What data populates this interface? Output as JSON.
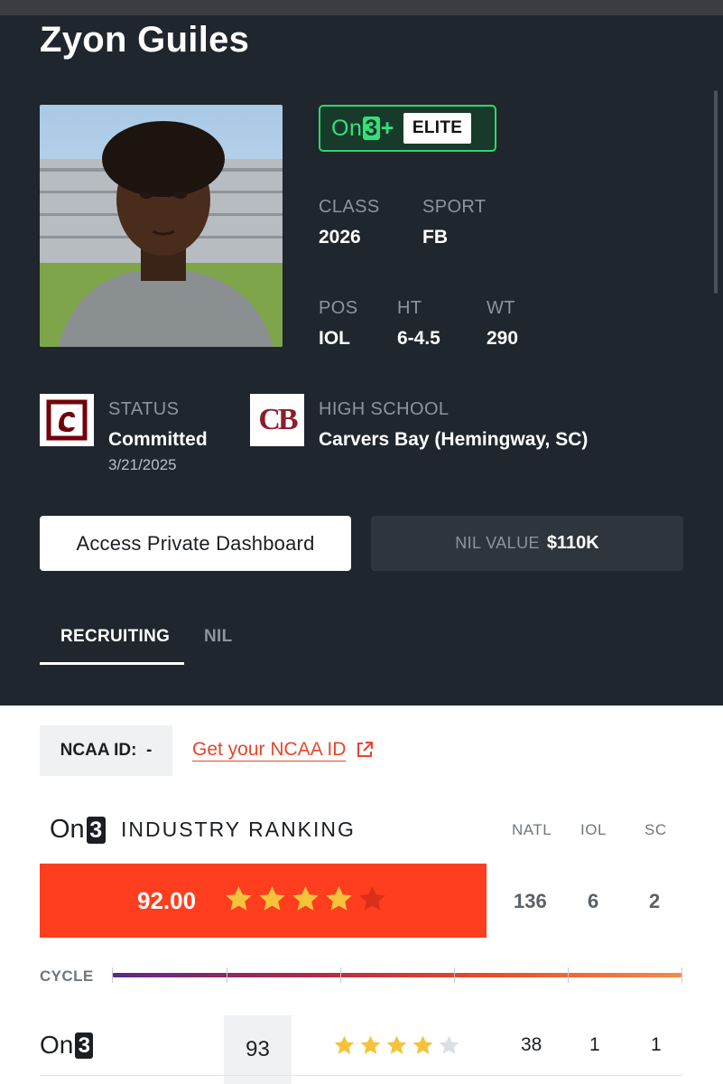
{
  "player": {
    "name": "Zyon Guiles",
    "badge": {
      "brand": "On3+",
      "tier": "ELITE"
    },
    "class_label": "CLASS",
    "class_value": "2026",
    "sport_label": "SPORT",
    "sport_value": "FB",
    "pos_label": "POS",
    "pos_value": "IOL",
    "ht_label": "HT",
    "ht_value": "6-4.5",
    "wt_label": "WT",
    "wt_value": "290"
  },
  "status": {
    "label": "STATUS",
    "value": "Committed",
    "date": "3/21/2025",
    "school_logo_icon": "gamecock-logo"
  },
  "high_school": {
    "label": "HIGH SCHOOL",
    "value": "Carvers Bay (Hemingway, SC)",
    "logo_text": "CB"
  },
  "actions": {
    "dashboard_label": "Access Private Dashboard",
    "nil_label": "NIL VALUE",
    "nil_value": "$110K"
  },
  "tabs": [
    {
      "label": "RECRUITING",
      "active": true
    },
    {
      "label": "NIL",
      "active": false
    }
  ],
  "ncaa": {
    "label": "NCAA ID:  -",
    "link_label": "Get your NCAA ID"
  },
  "industry_ranking": {
    "logo": "On3",
    "title": "INDUSTRY RANKING",
    "columns": [
      "NATL",
      "IOL",
      "SC"
    ],
    "rating": "92.00",
    "stars": 4,
    "max_stars": 5,
    "ranks": [
      "136",
      "6",
      "2"
    ]
  },
  "cycle": {
    "label": "CYCLE"
  },
  "on3_row": {
    "logo": "On3",
    "score": "93",
    "stars": 4,
    "max_stars": 5,
    "ranks": [
      "38",
      "1",
      "1"
    ]
  },
  "colors": {
    "hero_bg": "#1f262d",
    "accent_orange": "#ff3d1f",
    "elite_green": "#35e07a",
    "link_red": "#e8452a",
    "star_gold": "#f5c33b"
  }
}
